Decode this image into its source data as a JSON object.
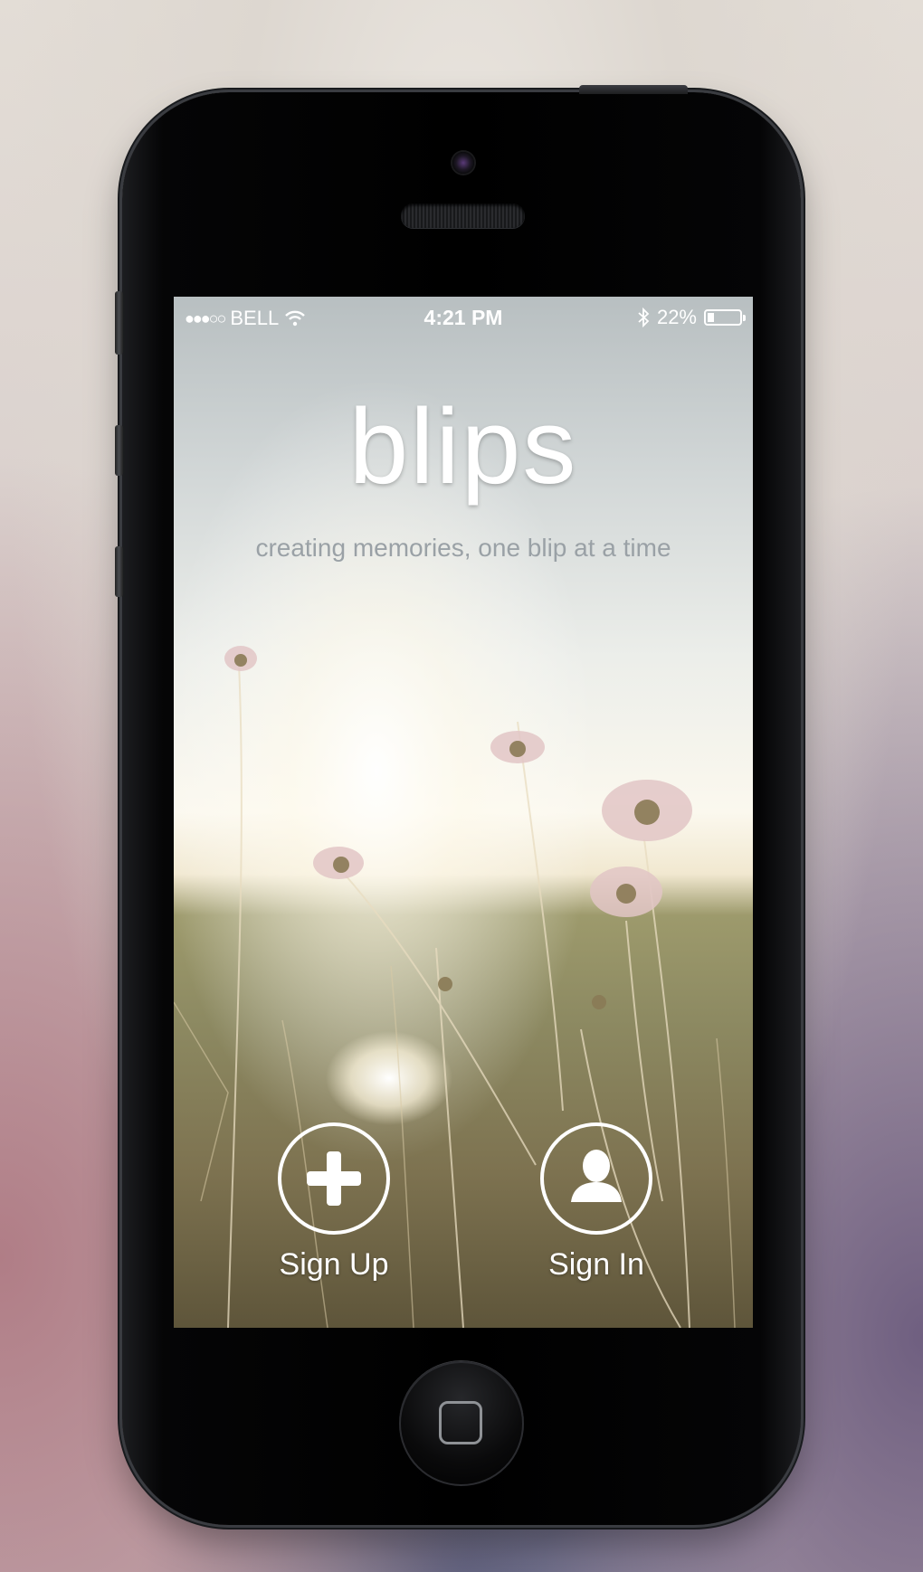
{
  "status_bar": {
    "signal": "●●●○○",
    "carrier": "BELL",
    "time": "4:21 PM",
    "battery": "22%",
    "battery_level": 0.22
  },
  "app": {
    "logo": "blips",
    "tagline": "creating memories, one blip at a time"
  },
  "actions": {
    "sign_up": {
      "label": "Sign Up",
      "icon": "plus-icon"
    },
    "sign_in": {
      "label": "Sign In",
      "icon": "user-icon"
    }
  },
  "colors": {
    "logo": "#ffffff",
    "tagline": "#9aa1a6",
    "button_outline": "#ffffff"
  }
}
